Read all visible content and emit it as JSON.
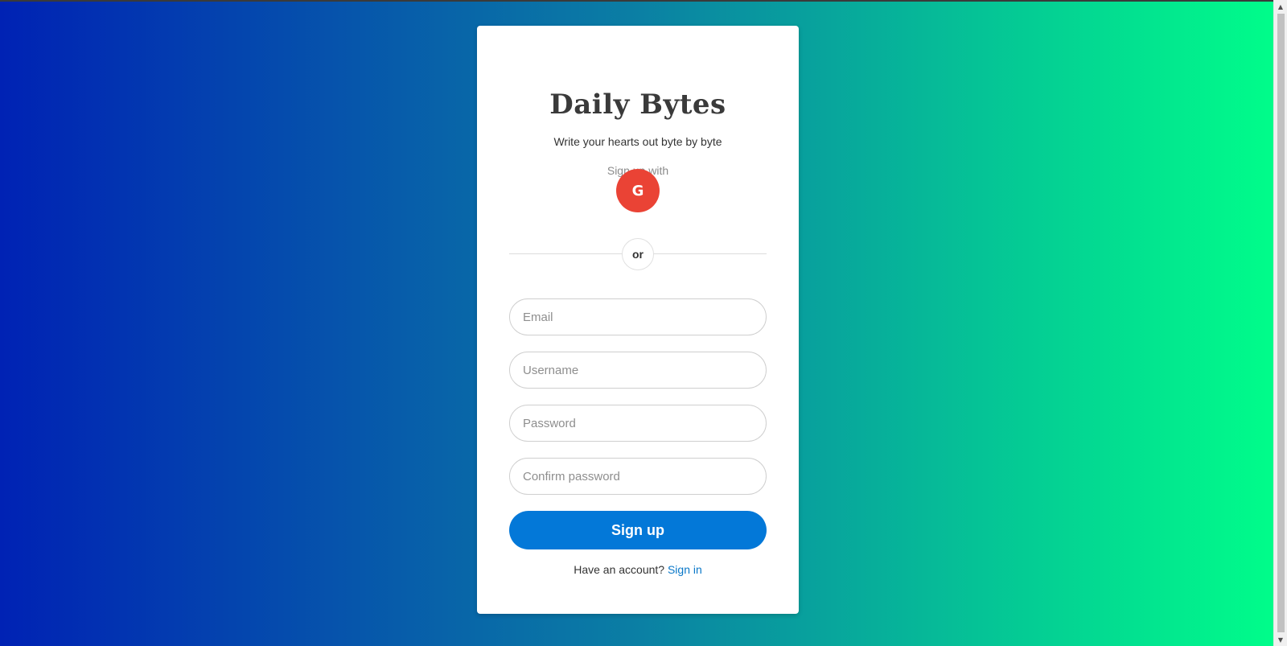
{
  "colors": {
    "gradient_start": "#0022b4",
    "gradient_end": "#00fd8a",
    "google_red": "#ea4335",
    "primary_button": "#0378d8",
    "link": "#0a78c8"
  },
  "card": {
    "title": "Daily Bytes",
    "subtitle": "Write your hearts out byte by byte",
    "signup_with": "Sign up with",
    "google_button": {
      "letter": "G",
      "icon": "google-icon"
    },
    "divider_label": "or",
    "fields": {
      "email_placeholder": "Email",
      "username_placeholder": "Username",
      "password_placeholder": "Password",
      "confirm_placeholder": "Confirm password"
    },
    "submit_label": "Sign up",
    "footer": {
      "prompt": "Have an account?",
      "link_label": "Sign in"
    }
  },
  "scrollbar": {
    "up_icon": "▲",
    "down_icon": "▼"
  }
}
